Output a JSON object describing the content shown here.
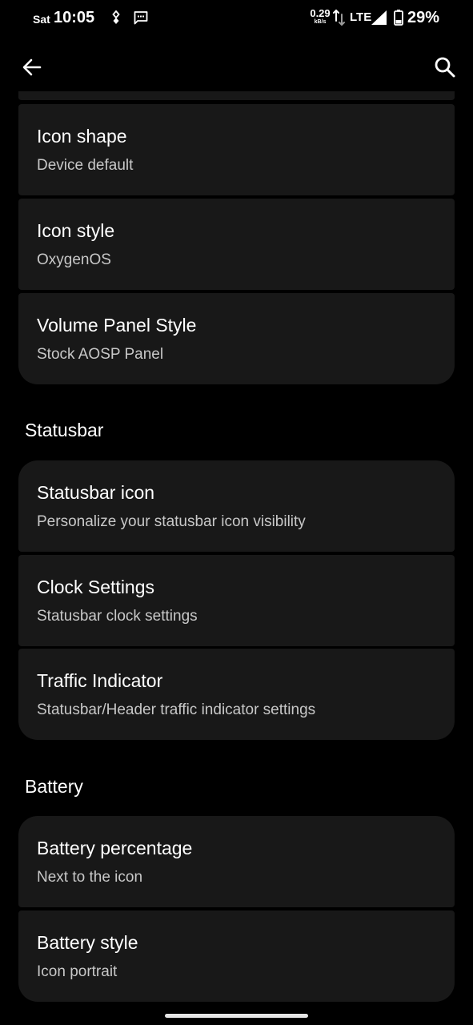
{
  "status_bar": {
    "day": "Sat",
    "time": "10:05",
    "net_speed": "0.29",
    "net_speed_unit": "kB/s",
    "network_type": "LTE",
    "battery_percent": "29%",
    "icons": [
      "vpn-key-icon",
      "message-icon",
      "data-arrows-icon",
      "signal-icon",
      "battery-icon"
    ]
  },
  "toolbar": {
    "back_icon": "arrow-back-icon",
    "search_icon": "search-icon"
  },
  "theme_items": [
    {
      "title": "Icon shape",
      "subtitle": "Device default"
    },
    {
      "title": "Icon style",
      "subtitle": "OxygenOS"
    },
    {
      "title": "Volume Panel Style",
      "subtitle": "Stock AOSP Panel"
    }
  ],
  "statusbar_section": {
    "header": "Statusbar",
    "items": [
      {
        "title": "Statusbar icon",
        "subtitle": "Personalize your statusbar icon visibility"
      },
      {
        "title": "Clock Settings",
        "subtitle": "Statusbar clock settings"
      },
      {
        "title": "Traffic Indicator",
        "subtitle": "Statusbar/Header traffic indicator settings"
      }
    ]
  },
  "battery_section": {
    "header": "Battery",
    "items": [
      {
        "title": "Battery percentage",
        "subtitle": "Next to the icon"
      },
      {
        "title": "Battery style",
        "subtitle": "Icon portrait"
      }
    ]
  },
  "colors": {
    "background": "#000000",
    "card": "#181818",
    "title_text": "#ffffff",
    "subtitle_text": "#c8c8c8"
  }
}
